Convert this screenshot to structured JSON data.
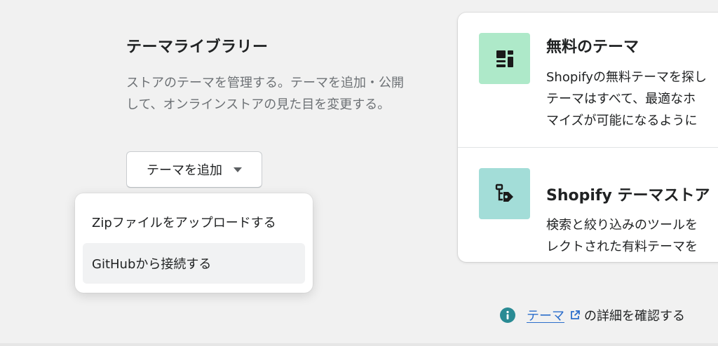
{
  "section": {
    "title": "テーマライブラリー",
    "description": "ストアのテーマを管理する。テーマを追加・公開して、オンラインストアの見た目を変更する。"
  },
  "add_button": {
    "label": "テーマを追加"
  },
  "dropdown": {
    "items": [
      {
        "label": "Zipファイルをアップロードする"
      },
      {
        "label": "GitHubから接続する"
      }
    ]
  },
  "cards": [
    {
      "title": "無料のテーマ",
      "description": "Shopifyの無料テーマを探し\nテーマはすべて、最適なホ\nマイズが可能になるように",
      "icon": "theme-layout-icon",
      "tile_color": "#aee9c9"
    },
    {
      "title": "Shopify テーマストア",
      "description": "検索と絞り込みのツールを\nレクトされた有料テーマを",
      "icon": "tag-sitemap-icon",
      "tile_color": "#a3ddd8"
    }
  ],
  "footer": {
    "link_text": "テーマ",
    "suffix": "の詳細を確認する"
  },
  "colors": {
    "background": "#f1f1f1",
    "link": "#2c6ecb",
    "info_icon": "#2a8b94"
  }
}
